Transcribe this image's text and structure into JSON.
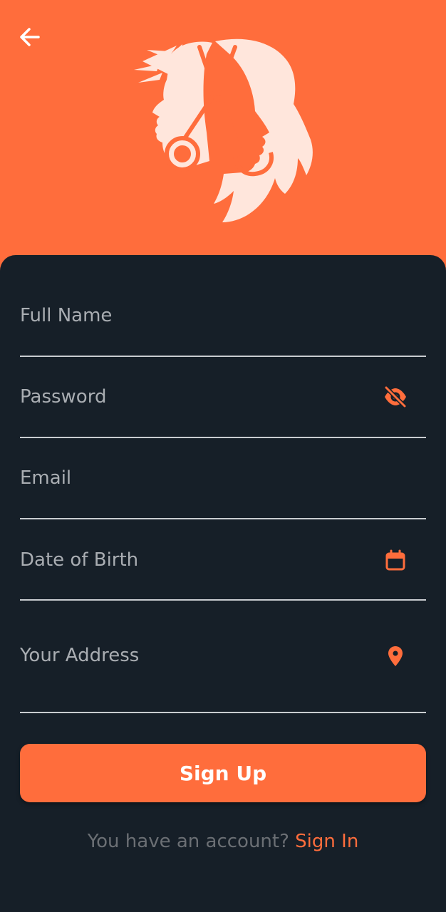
{
  "colors": {
    "accent": "#ff6d3c",
    "background": "#161f28",
    "field_line": "#c9ccd0",
    "placeholder": "#a9adb2",
    "muted_text": "#6b6f74",
    "logo_fill": "#ffe6dc"
  },
  "header": {
    "back_icon": "arrow-left-icon",
    "logo_icon": "barber-scissors-logo-icon"
  },
  "form": {
    "full_name": {
      "placeholder": "Full Name",
      "value": ""
    },
    "password": {
      "placeholder": "Password",
      "value": "",
      "icon": "eye-off-icon"
    },
    "email": {
      "placeholder": "Email",
      "value": ""
    },
    "dob": {
      "placeholder": "Date of Birth",
      "value": "",
      "icon": "calendar-icon"
    },
    "address": {
      "placeholder": "Your Address",
      "value": "",
      "icon": "location-pin-icon"
    }
  },
  "actions": {
    "signup_label": "Sign Up"
  },
  "footer": {
    "prompt": "You have an account? ",
    "signin_label": "Sign In"
  }
}
